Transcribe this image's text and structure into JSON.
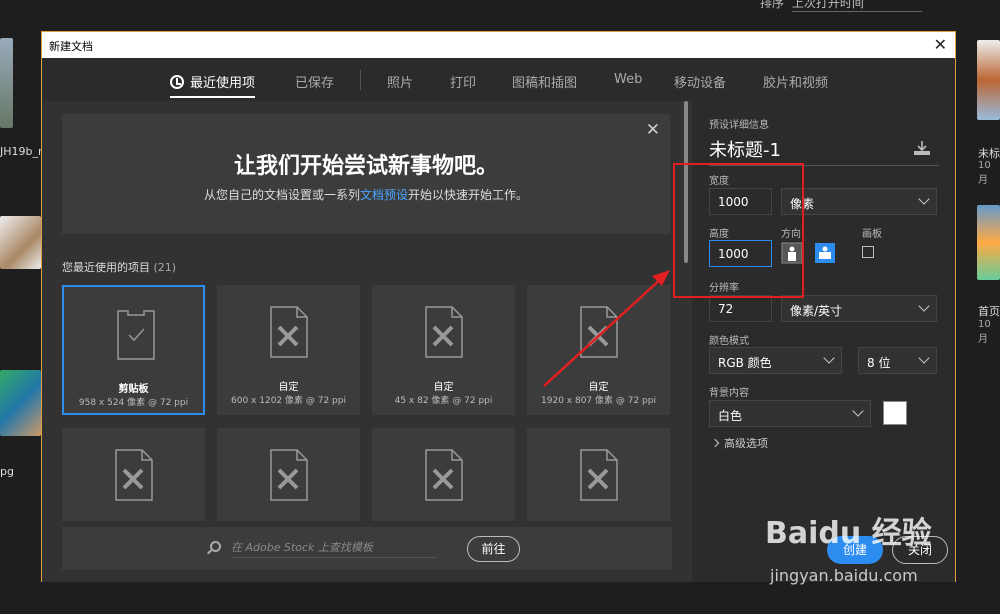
{
  "background": {
    "sort_label": "排序",
    "sort_value": "上次打开时间",
    "left_labels": [
      "JH19b_n",
      "pg"
    ],
    "right_items": [
      {
        "title": "未标",
        "date": "10月"
      },
      {
        "title": "首页",
        "date": "10月"
      }
    ]
  },
  "dialog": {
    "title": "新建文档",
    "tabs": [
      {
        "label": "最近使用项"
      },
      {
        "label": "已保存"
      },
      {
        "label": "照片"
      },
      {
        "label": "打印"
      },
      {
        "label": "图稿和插图"
      },
      {
        "label": "Web"
      },
      {
        "label": "移动设备"
      },
      {
        "label": "胶片和视频"
      }
    ],
    "welcome": {
      "heading": "让我们开始尝试新事物吧。",
      "text_before": "从您自己的文档设置或一系列",
      "link": "文档预设",
      "text_after": "开始以快速开始工作。"
    },
    "recent": {
      "heading": "您最近使用的项目",
      "count": "(21)",
      "items": [
        {
          "name": "剪贴板",
          "meta": "958 x 524 像素 @ 72 ppi"
        },
        {
          "name": "自定",
          "meta": "600 x 1202 像素 @ 72 ppi"
        },
        {
          "name": "自定",
          "meta": "45 x 82 像素 @ 72 ppi"
        },
        {
          "name": "自定",
          "meta": "1920 x 807 像素 @ 72 ppi"
        }
      ]
    },
    "search": {
      "placeholder": "在 Adobe Stock 上查找模板",
      "go_label": "前往"
    },
    "preset": {
      "section_label": "预设详细信息",
      "doc_name": "未标题-1",
      "width_label": "宽度",
      "width_value": "1000",
      "width_unit": "像素",
      "height_label": "高度",
      "height_value": "1000",
      "orientation_label": "方向",
      "artboard_label": "画板",
      "resolution_label": "分辨率",
      "resolution_value": "72",
      "resolution_unit": "像素/英寸",
      "color_mode_label": "颜色模式",
      "color_mode_value": "RGB 颜色",
      "bit_depth": "8 位",
      "background_label": "背景内容",
      "background_value": "白色",
      "advanced_label": "高级选项",
      "create_label": "创建",
      "close_label": "关闭"
    }
  },
  "watermark": {
    "text": "Baidu 经验",
    "url": "jingyan.baidu.com"
  }
}
